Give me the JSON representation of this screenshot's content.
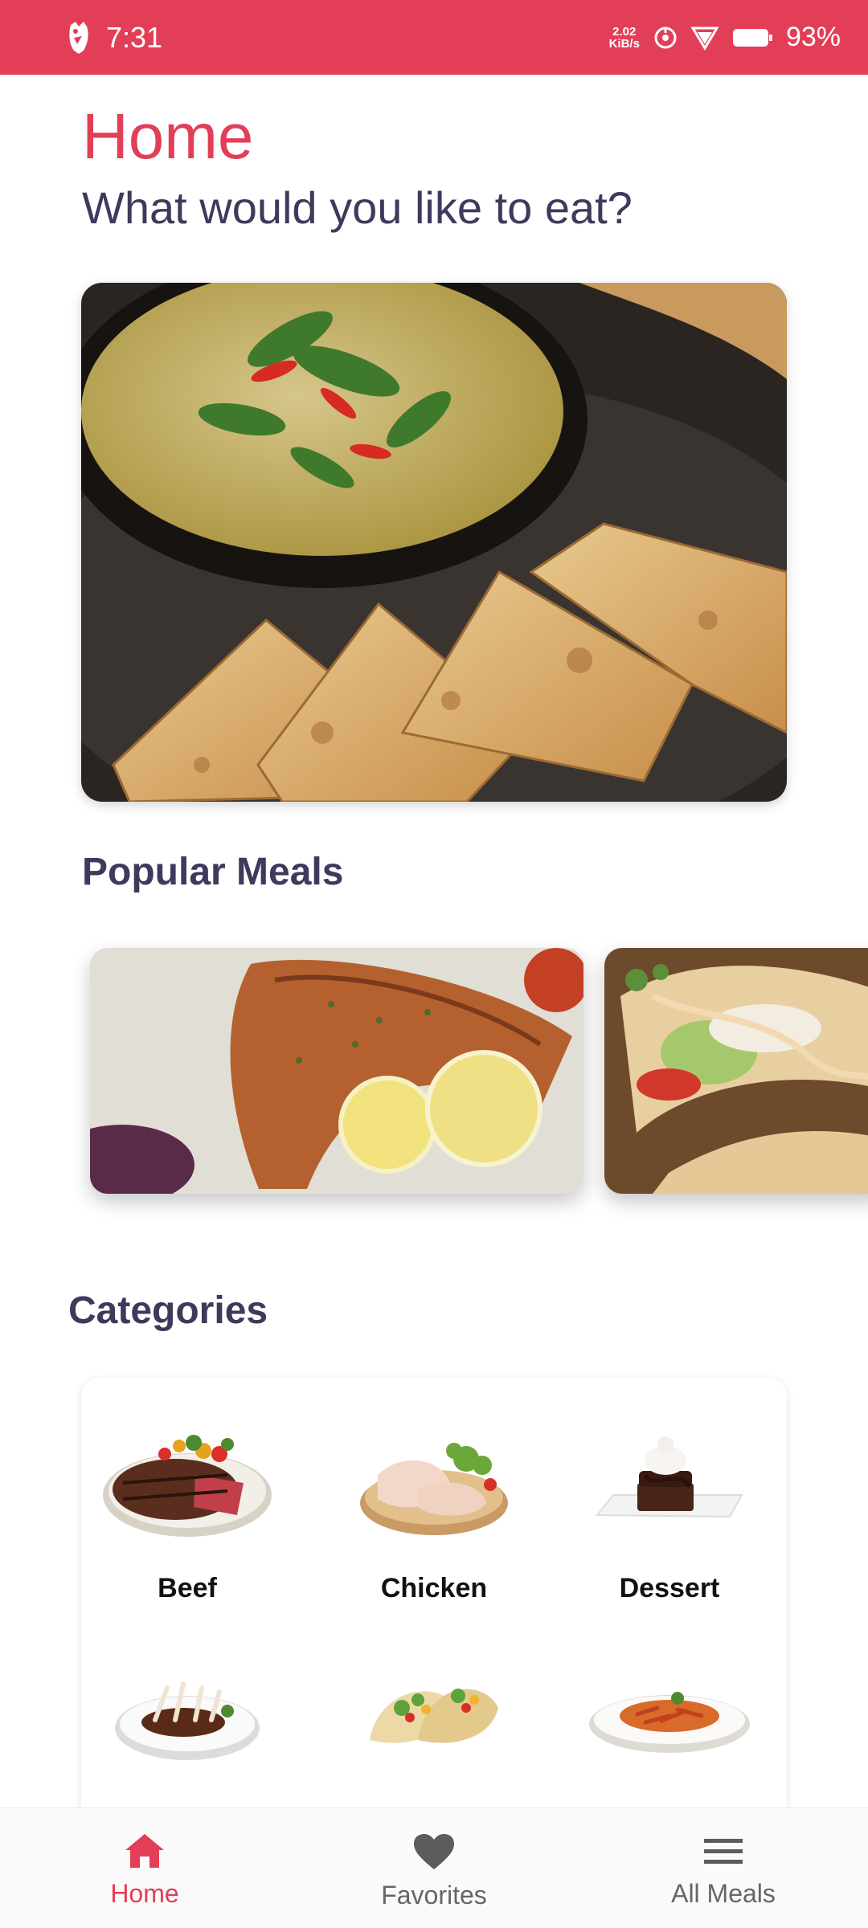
{
  "status_bar": {
    "time": "7:31",
    "net_speed_value": "2.02",
    "net_speed_unit": "KiB/s",
    "battery": "93%"
  },
  "header": {
    "title": "Home",
    "subtitle": "What would you like to eat?"
  },
  "sections": {
    "popular": "Popular Meals",
    "categories": "Categories"
  },
  "categories": [
    {
      "label": "Beef",
      "icon": "beef-plate-icon"
    },
    {
      "label": "Chicken",
      "icon": "chicken-plate-icon"
    },
    {
      "label": "Dessert",
      "icon": "dessert-plate-icon"
    },
    {
      "label": "",
      "icon": "lamb-plate-icon"
    },
    {
      "label": "",
      "icon": "taco-icon"
    },
    {
      "label": "",
      "icon": "pasta-plate-icon"
    }
  ],
  "bottom_nav": {
    "items": [
      {
        "label": "Home",
        "icon": "home-icon",
        "active": true
      },
      {
        "label": "Favorites",
        "icon": "heart-icon",
        "active": false
      },
      {
        "label": "All Meals",
        "icon": "menu-icon",
        "active": false
      }
    ]
  },
  "colors": {
    "accent": "#e23e57",
    "heading": "#3d3a5c"
  }
}
